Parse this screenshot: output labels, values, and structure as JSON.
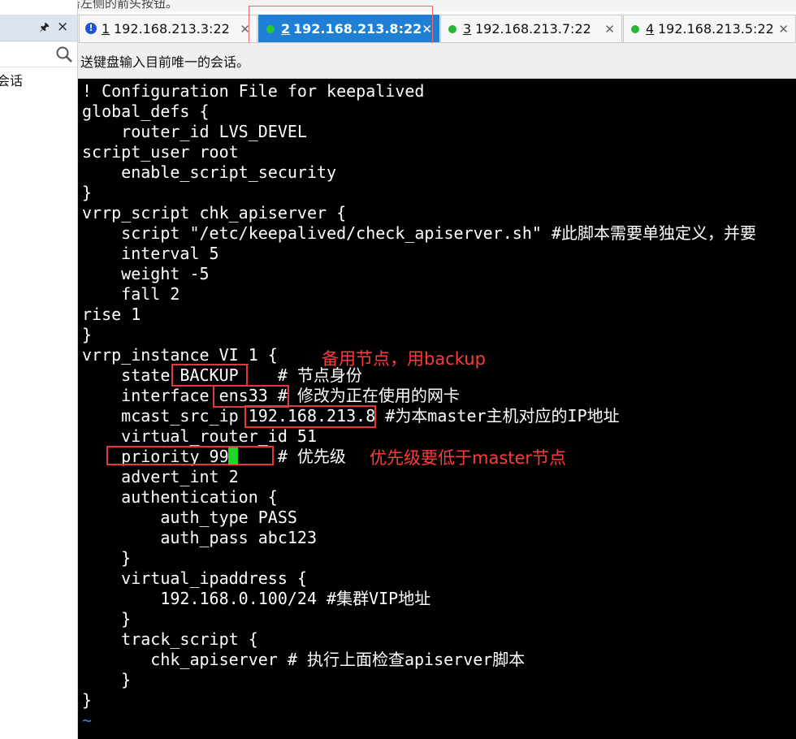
{
  "top_hint": "当前会话，点击左侧的箭头按钮。",
  "left_panel": {
    "pin_icon": "pin-icon",
    "close_icon": "close-icon",
    "search_icon": "search-icon",
    "session_entry": "会话"
  },
  "tabs": [
    {
      "number": "1",
      "label": "192.168.213.3:22",
      "status": "warning",
      "active": false
    },
    {
      "number": "2",
      "label": "192.168.213.8:22",
      "status": "connected",
      "active": true
    },
    {
      "number": "3",
      "label": "192.168.213.7:22",
      "status": "connected",
      "active": false
    },
    {
      "number": "4",
      "label": "192.168.213.5:22",
      "status": "connected",
      "active": false
    }
  ],
  "send_bar": {
    "text": "送键盘输入目前唯一的会话。"
  },
  "terminal": {
    "lines": [
      "! Configuration File for keepalived",
      "global_defs {",
      "    router_id LVS_DEVEL",
      "script_user root",
      "    enable_script_security",
      "}",
      "vrrp_script chk_apiserver {",
      "    script \"/etc/keepalived/check_apiserver.sh\" #此脚本需要单独定义，并要",
      "    interval 5",
      "    weight -5",
      "    fall 2",
      "rise 1",
      "}",
      "vrrp_instance VI_1 {",
      "    state BACKUP    # 节点身份",
      "    interface ens33 # 修改为正在使用的网卡",
      "    mcast_src_ip 192.168.213.8 #为本master主机对应的IP地址",
      "    virtual_router_id 51",
      "    priority 99     # 优先级",
      "    advert_int 2",
      "    authentication {",
      "        auth_type PASS",
      "        auth_pass abc123",
      "    }",
      "    virtual_ipaddress {",
      "        192.168.0.100/24 #集群VIP地址",
      "    }",
      "    track_script {",
      "       chk_apiserver # 执行上面检查apiserver脚本",
      "    }",
      "}",
      "~"
    ]
  },
  "annotations": {
    "backup_note": "备用节点，用backup",
    "priority_note": "优先级要低于master节点"
  },
  "colors": {
    "active_tab": "#1f7fd4",
    "status_connected": "#27b438",
    "status_warning": "#1a55d4",
    "annotation_red": "#ff3a3a",
    "terminal_bg": "#000000",
    "terminal_fg": "#ffffff",
    "cursor": "#22d32a",
    "tilde": "#3a7fd9"
  }
}
